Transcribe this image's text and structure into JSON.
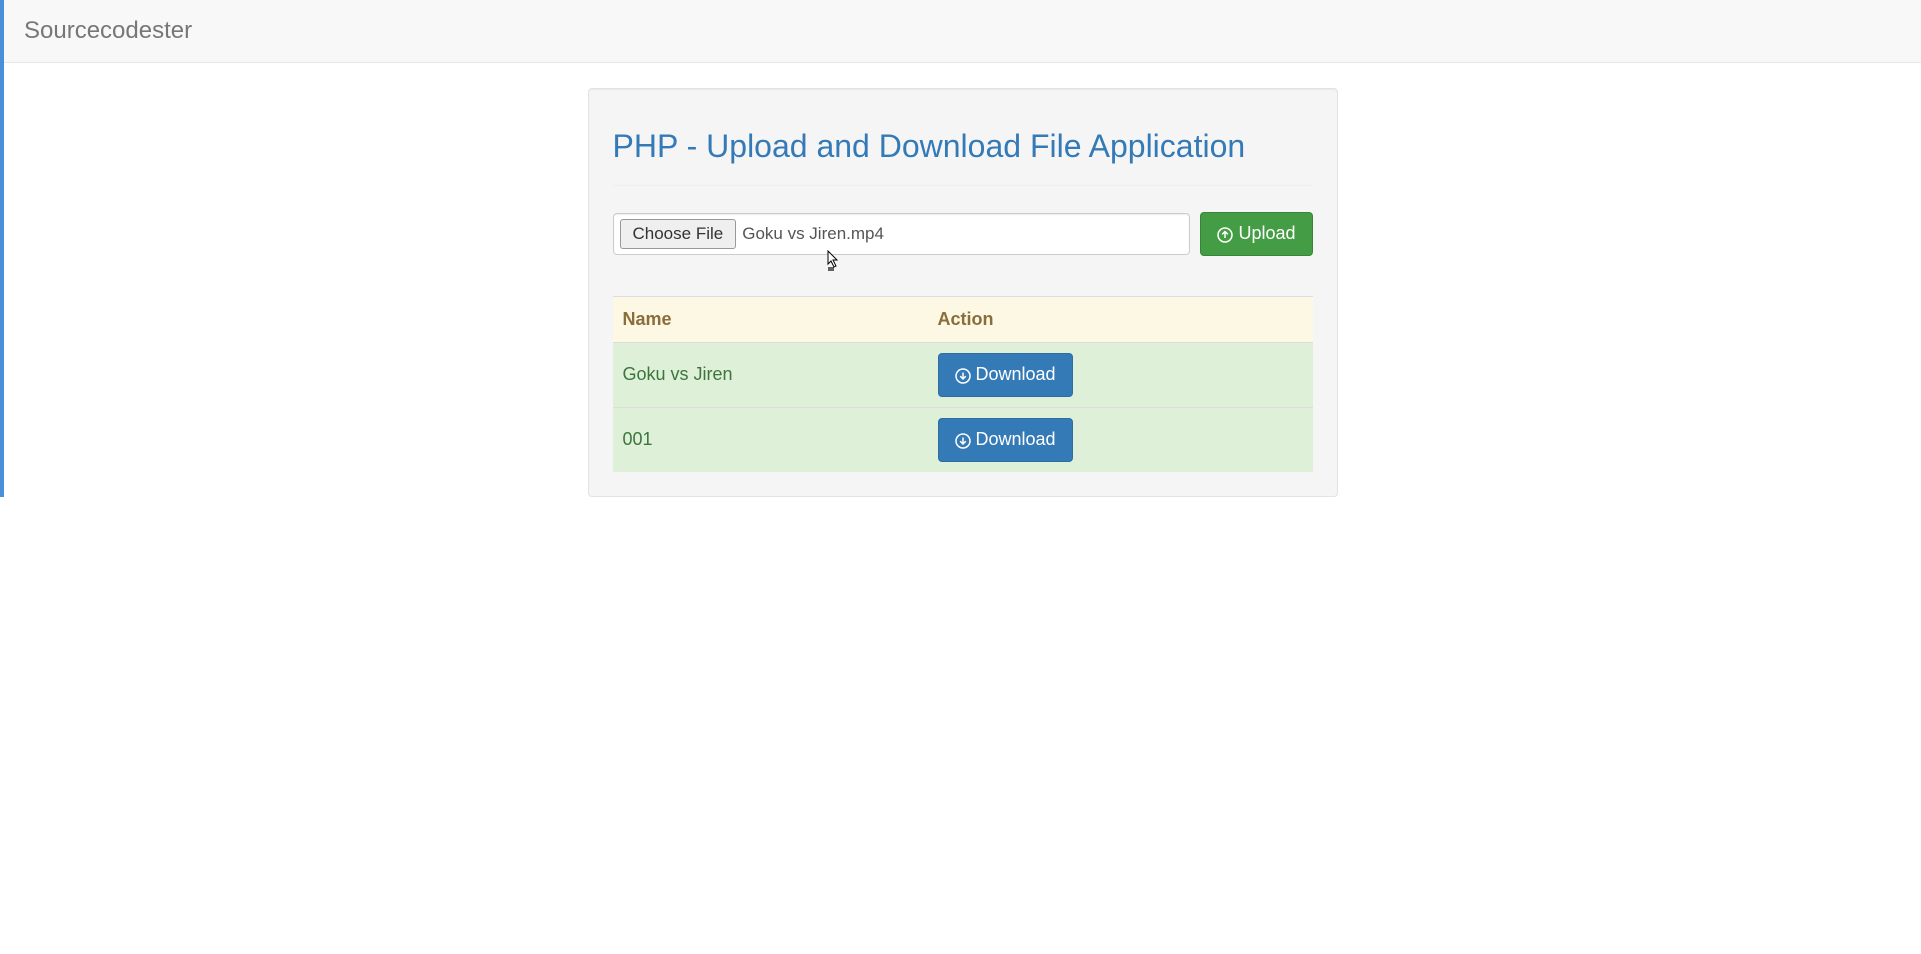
{
  "navbar": {
    "brand": "Sourcecodester"
  },
  "page": {
    "title": "PHP - Upload and Download File Application"
  },
  "upload": {
    "choose_label": "Choose File",
    "selected_file": "Goku vs Jiren.mp4",
    "button_label": " Upload"
  },
  "table": {
    "headers": {
      "name": "Name",
      "action": "Action"
    },
    "download_label": " Download",
    "rows": [
      {
        "name": "Goku vs Jiren"
      },
      {
        "name": "001"
      }
    ]
  }
}
